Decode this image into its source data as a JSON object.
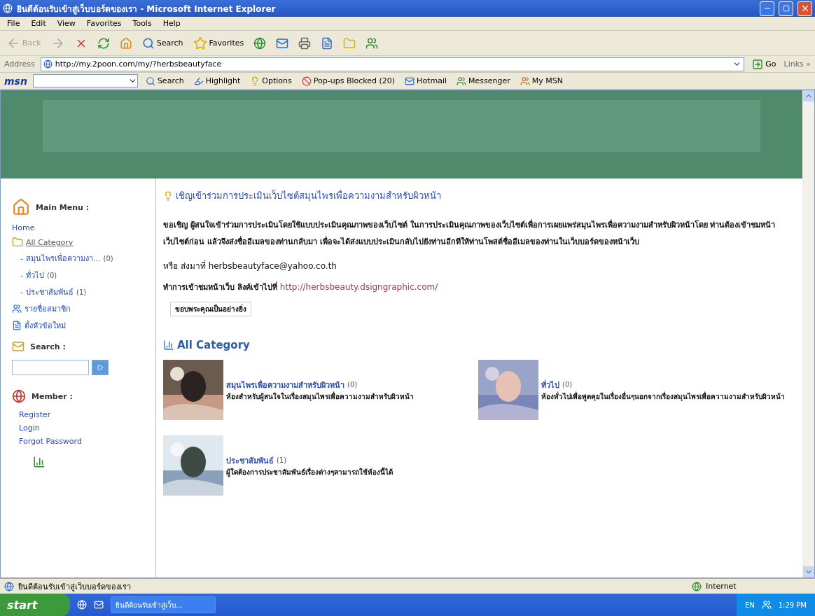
{
  "window": {
    "title": "ยินดีต้อนรับเข้าสู่เว็บบอร์ดของเรา - Microsoft Internet Explorer"
  },
  "menu": [
    "File",
    "Edit",
    "View",
    "Favorites",
    "Tools",
    "Help"
  ],
  "toolbar": {
    "back": {
      "label": "Back",
      "disabled": true
    },
    "search": "Search",
    "favorites": "Favorites"
  },
  "address": {
    "label": "Address",
    "url": "http://my.2poon.com/my/?herbsbeautyface",
    "go": "Go",
    "links": "Links »"
  },
  "msn_bar": {
    "logo": "msn",
    "search": "Search",
    "highlight": "Highlight",
    "options": "Options",
    "popups": "Pop-ups Blocked (20)",
    "hotmail": "Hotmail",
    "messenger": "Messenger",
    "my_msn": "My MSN"
  },
  "sidebar": {
    "main_menu": "Main Menu :",
    "home": "Home",
    "all_category": "All Category",
    "categories": [
      {
        "bullet": "-",
        "name": "สมุนไพรเพื่อความงา...",
        "count": "(0)"
      },
      {
        "bullet": "-",
        "name": "ทั่วไป",
        "count": "(0)"
      },
      {
        "bullet": "-",
        "name": "ประชาสัมพันธ์",
        "count": "(1)"
      }
    ],
    "links": [
      "รายชื่อสมาชิก",
      "ตั้งหัวข้อใหม่"
    ],
    "search_title": "Search :",
    "member_title": "Member :",
    "member_links": [
      "Register",
      "Login",
      "Forgot Password"
    ]
  },
  "announcement": {
    "title": "เชิญเข้าร่วมการประเมินเว็บไซต์สมุนไพรเพื่อความงามสำหรับผิวหน้า",
    "body": "ขอเชิญ ผู้สนใจเข้าร่วมการประเมินโดยใช้แบบประเมินคุณภาพของเว็บไซต์ ในการประเมินคุณภาพของเว็บไซต์เพื่อการเผยแพร่สมุนไพรเพื่อความงามสำหรับผิวหน้าโดย ท่านต้องเข้าชมหน้าเว็บไซต์ก่อน แล้วจึงส่งชื่ออีเมลของท่านกลับมา เพื่อจะได้ส่งแบบประเมินกลับไปยังท่านอีกทีให้ท่านโพสต์ชื่ออีเมลของท่านในเว็บบอร์ดของหน้าเว็บ",
    "email_line": "หรือ ส่งมาที่ herbsbeautyface@yahoo.co.th",
    "link_prefix": "ทำการเข้าชมหน้าเว็บ ลิงค์เข้าไปที่",
    "link": "http://herbsbeauty.dsigngraphic.com/",
    "thanks": "ขอบพระคุณเป็นอย่างยิ่ง"
  },
  "category_section": {
    "title": "All Category",
    "items": [
      {
        "name": "สมุนไพรเพื่อความงามสำหรับผิวหน้า",
        "count": "(0)",
        "description": "ห้องสำหรับผู้สนใจในเรื่องสมุนไพรเพื่อความงามสำหรับผิวหน้า"
      },
      {
        "name": "ทั่วไป",
        "count": "(0)",
        "description": "ห้องทั่วไปเพื่อพูดคุยในเรื่องอื่นๆนอกจากเรื่องสมุนไพรเพื่อความงามสำหรับผิวหน้า"
      },
      {
        "name": "ประชาสัมพันธ์",
        "count": "(1)",
        "description": "ผู้ใดต้องการประชาสัมพันธ์เรื่องต่างๆสามารถใช้ห้องนี้ได้"
      }
    ]
  },
  "status_bar": {
    "text": "ยินดีต้อนรับเข้าสู่เว็บบอร์ดของเรา",
    "zone": "Internet"
  },
  "taskbar": {
    "start": "start",
    "window": "ยินดีต้อนรับเข้าสู่เว็บ...",
    "language": "EN",
    "clock": "1:29 PM"
  }
}
